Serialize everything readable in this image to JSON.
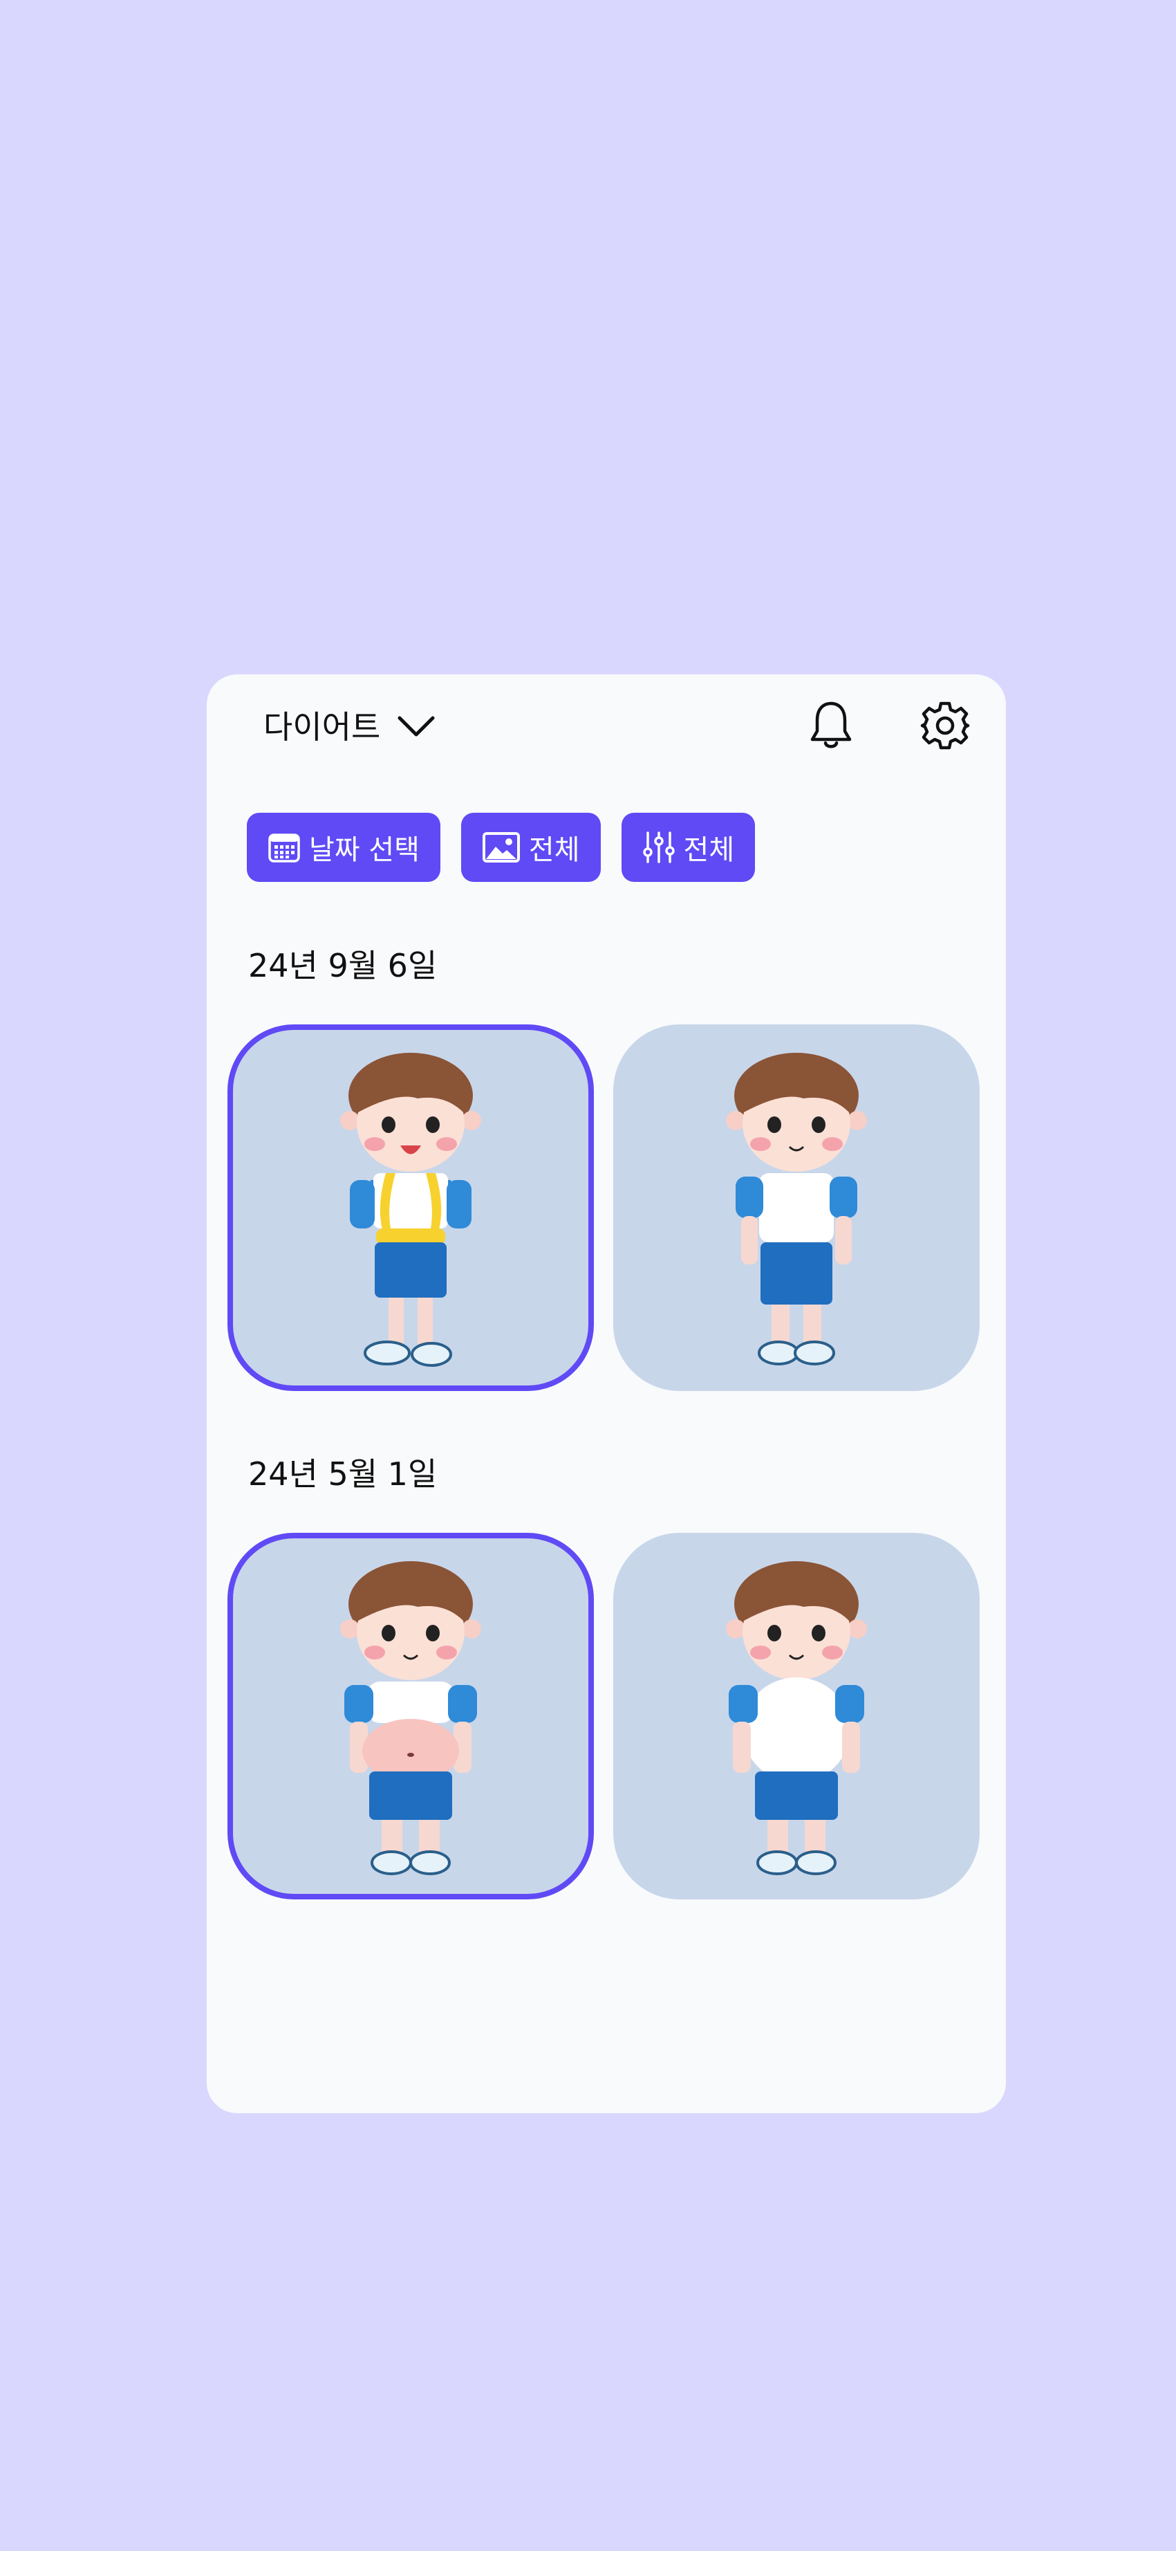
{
  "header": {
    "title": "다이어트"
  },
  "filters": [
    {
      "label": "날짜 선택",
      "icon": "calendar-icon"
    },
    {
      "label": "전체",
      "icon": "image-icon"
    },
    {
      "label": "전체",
      "icon": "sliders-icon"
    }
  ],
  "groups": [
    {
      "date": "24년 9월 6일",
      "photos": [
        {
          "image": "boy-with-measuring-tape",
          "selected": true
        },
        {
          "image": "boy-standing-slim",
          "selected": false
        }
      ]
    },
    {
      "date": "24년 5월 1일",
      "photos": [
        {
          "image": "boy-showing-belly",
          "selected": true
        },
        {
          "image": "boy-standing-chubby",
          "selected": false
        }
      ]
    }
  ],
  "colors": {
    "accent": "#5f4af5",
    "background": "#dad7fe",
    "card": "#f9fafc",
    "photo_bg": "#c8d6ea"
  }
}
